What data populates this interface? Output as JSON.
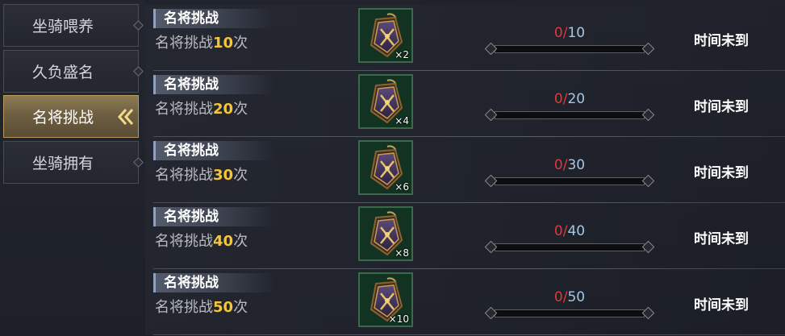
{
  "sidebar": {
    "tabs": [
      {
        "label": "坐骑喂养",
        "active": false
      },
      {
        "label": "久负盛名",
        "active": false
      },
      {
        "label": "名将挑战",
        "active": true
      },
      {
        "label": "坐骑拥有",
        "active": false
      }
    ]
  },
  "tasks": [
    {
      "title": "名将挑战",
      "desc_prefix": "名将挑战",
      "desc_num": "10",
      "desc_suffix": "次",
      "reward_icon": "challenge-token-icon",
      "reward_count": "×2",
      "progress_current": "0",
      "progress_sep": "/",
      "progress_total": "10",
      "progress_fraction": 0,
      "status": "时间未到"
    },
    {
      "title": "名将挑战",
      "desc_prefix": "名将挑战",
      "desc_num": "20",
      "desc_suffix": "次",
      "reward_icon": "challenge-token-icon",
      "reward_count": "×4",
      "progress_current": "0",
      "progress_sep": "/",
      "progress_total": "20",
      "progress_fraction": 0,
      "status": "时间未到"
    },
    {
      "title": "名将挑战",
      "desc_prefix": "名将挑战",
      "desc_num": "30",
      "desc_suffix": "次",
      "reward_icon": "challenge-token-icon",
      "reward_count": "×6",
      "progress_current": "0",
      "progress_sep": "/",
      "progress_total": "30",
      "progress_fraction": 0,
      "status": "时间未到"
    },
    {
      "title": "名将挑战",
      "desc_prefix": "名将挑战",
      "desc_num": "40",
      "desc_suffix": "次",
      "reward_icon": "challenge-token-icon",
      "reward_count": "×8",
      "progress_current": "0",
      "progress_sep": "/",
      "progress_total": "40",
      "progress_fraction": 0,
      "status": "时间未到"
    },
    {
      "title": "名将挑战",
      "desc_prefix": "名将挑战",
      "desc_num": "50",
      "desc_suffix": "次",
      "reward_icon": "challenge-token-icon",
      "reward_count": "×10",
      "progress_current": "0",
      "progress_sep": "/",
      "progress_total": "50",
      "progress_fraction": 0,
      "status": "时间未到"
    }
  ],
  "colors": {
    "accent_gold": "#f3c63a",
    "progress_current": "#e0383a",
    "progress_total": "#a7c6e4",
    "active_tab": "#8d7b54"
  }
}
